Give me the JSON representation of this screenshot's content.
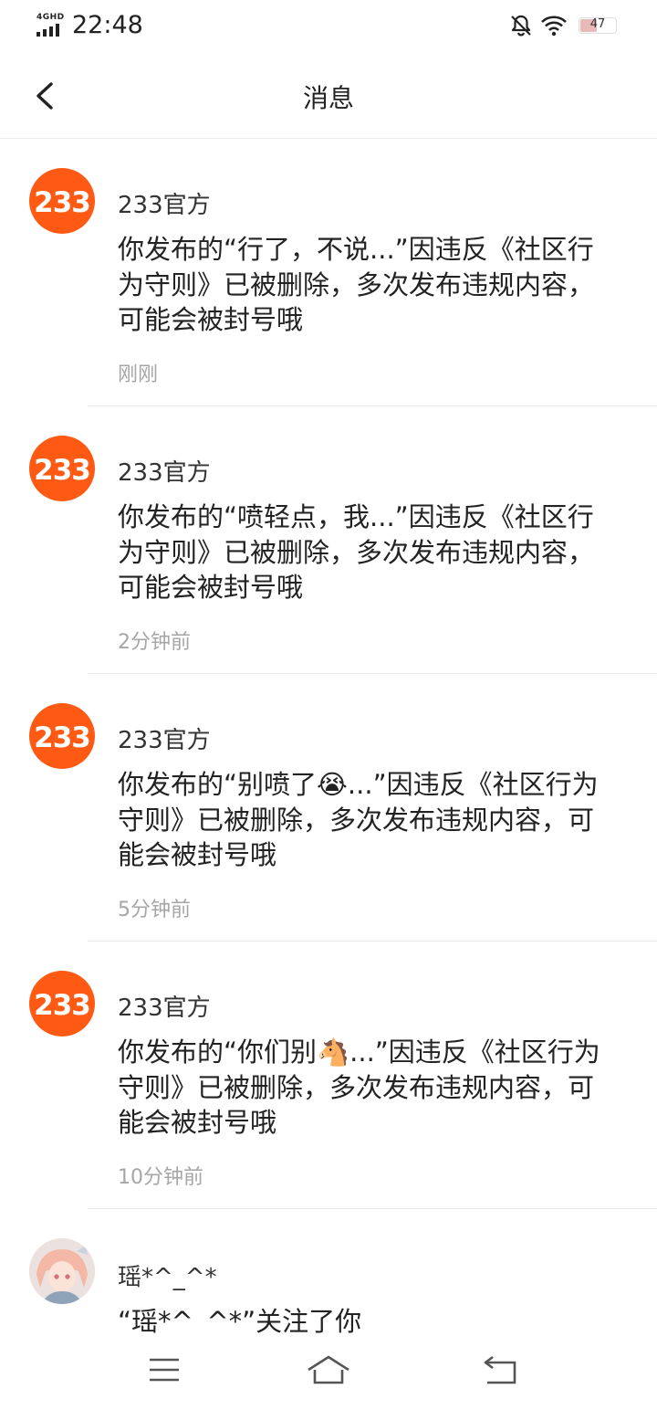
{
  "status_bar": {
    "network": "4GHD",
    "time": "22:48",
    "battery": "47"
  },
  "header": {
    "title": "消息"
  },
  "messages": [
    {
      "sender": "233官方",
      "logo": "233",
      "text": "你发布的“行了，不说...”因违反《社区行为守则》已被删除，多次发布违规内容，可能会被封号哦",
      "time": "刚刚"
    },
    {
      "sender": "233官方",
      "logo": "233",
      "text": "你发布的“喷轻点，我...”因违反《社区行为守则》已被删除，多次发布违规内容，可能会被封号哦",
      "time": "2分钟前"
    },
    {
      "sender": "233官方",
      "logo": "233",
      "text": "你发布的“别喷了😭...”因违反《社区行为守则》已被删除，多次发布违规内容，可能会被封号哦",
      "time": "5分钟前"
    },
    {
      "sender": "233官方",
      "logo": "233",
      "text": "你发布的“你们别🐴...”因违反《社区行为守则》已被删除，多次发布违规内容，可能会被封号哦",
      "time": "10分钟前"
    }
  ],
  "follow": {
    "sender": "瑶*^_^*",
    "text": "“瑶*^_^*”关注了你"
  },
  "colors": {
    "brand": "#ff5a14",
    "divider": "#ececec",
    "muted": "#a6a6a6"
  },
  "icons": [
    "back-arrow-icon",
    "bell-off-icon",
    "wifi-icon",
    "battery-icon",
    "menu-icon",
    "home-icon",
    "return-icon"
  ]
}
